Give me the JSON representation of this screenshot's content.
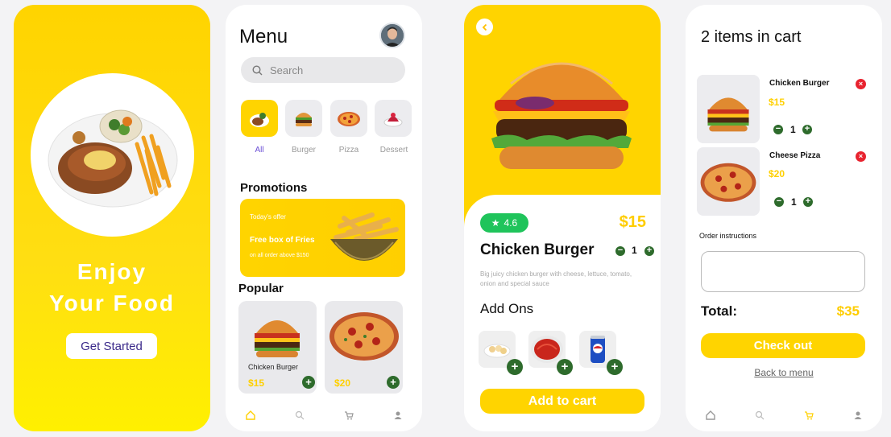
{
  "colors": {
    "primary": "#ffd400",
    "green": "#2e6b2c",
    "rating": "#1fc45b",
    "remove": "#e8232f",
    "accent_purple": "#6b4fd6"
  },
  "splash": {
    "line1": "Enjoy",
    "line2": "Your Food",
    "cta": "Get Started"
  },
  "menu": {
    "title": "Menu",
    "search_placeholder": "Search",
    "categories": [
      {
        "label": "All",
        "icon": "all-food-icon"
      },
      {
        "label": "Burger",
        "icon": "burger-icon"
      },
      {
        "label": "Pizza",
        "icon": "pizza-icon"
      },
      {
        "label": "Dessert",
        "icon": "dessert-icon"
      }
    ],
    "promotions_title": "Promotions",
    "promo": {
      "kicker": "Today's offer",
      "headline": "Free box of Fries",
      "sub": "on all order above $150"
    },
    "popular_title": "Popular",
    "popular": [
      {
        "name": "Chicken Burger",
        "price": "$15"
      },
      {
        "name": "",
        "price": "$20"
      }
    ],
    "nav": [
      "home-icon",
      "search-icon",
      "cart-icon",
      "profile-icon"
    ]
  },
  "product": {
    "rating": "4.6",
    "price": "$15",
    "name": "Chicken Burger",
    "qty": "1",
    "description": "Big juicy chicken burger with cheese, lettuce, tomato, onion and special sauce",
    "addons_title": "Add Ons",
    "addons": [
      "nachos-icon",
      "tomato-soup-icon",
      "soda-can-icon"
    ],
    "cta": "Add to cart"
  },
  "cart": {
    "title": "2 items in cart",
    "items": [
      {
        "name": "Chicken Burger",
        "price": "$15",
        "qty": "1"
      },
      {
        "name": "Cheese Pizza",
        "price": "$20",
        "qty": "1"
      }
    ],
    "instructions_label": "Order instructions",
    "total_label": "Total:",
    "total_value": "$35",
    "checkout": "Check out",
    "back": "Back to menu"
  }
}
